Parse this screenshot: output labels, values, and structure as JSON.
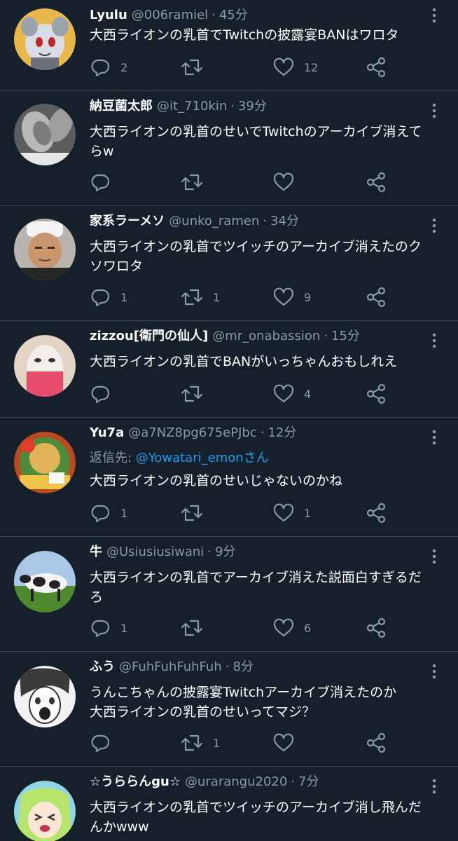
{
  "timeline": {
    "tweets": [
      {
        "name": "Lyulu",
        "handle": "@006ramiel",
        "time": "45分",
        "lines": [
          "大西ライオンの乳首でTwitchの披露宴BANはワロタ"
        ],
        "replies": "2",
        "retweets": "",
        "likes": "12"
      },
      {
        "name": "納豆菌太郎",
        "handle": "@it_710kin",
        "time": "39分",
        "lines": [
          "大西ライオンの乳首のせいでTwitchのアーカイブ消えて",
          "らw"
        ],
        "replies": "",
        "retweets": "",
        "likes": ""
      },
      {
        "name": "家系ラーメソ",
        "handle": "@unko_ramen",
        "time": "34分",
        "lines": [
          "大西ライオンの乳首でツイッチのアーカイブ消えたのク",
          "ソワロタ"
        ],
        "replies": "1",
        "retweets": "1",
        "likes": "9"
      },
      {
        "name": "zizzou[衛門の仙人]",
        "handle": "@mr_onabassion",
        "time": "15分",
        "lines": [
          "大西ライオンの乳首でBANがいっちゃんおもしれえ"
        ],
        "replies": "",
        "retweets": "",
        "likes": "4"
      },
      {
        "name": "Yu7a",
        "handle": "@a7NZ8pg675ePJbc",
        "time": "12分",
        "reply_prefix": "返信先:",
        "reply_mention": "@Yowatari_emonさん",
        "lines": [
          "大西ライオンの乳首のせいじゃないのかね"
        ],
        "replies": "1",
        "retweets": "",
        "likes": "1"
      },
      {
        "name": "牛",
        "handle": "@Usiusiusiwani",
        "time": "9分",
        "lines": [
          "大西ライオンの乳首でアーカイブ消えた説面白すぎるだ",
          "ろ"
        ],
        "replies": "1",
        "retweets": "",
        "likes": "6"
      },
      {
        "name": "ふう",
        "handle": "@FuhFuhFuhFuh",
        "time": "8分",
        "lines": [
          "うんこちゃんの披露宴Twitchアーカイブ消えたのか",
          "大西ライオンの乳首のせいってマジ？"
        ],
        "replies": "",
        "retweets": "1",
        "likes": ""
      },
      {
        "name": "☆うららんgu☆",
        "handle": "@urarangu2020",
        "time": "7分",
        "lines": [
          "大西ライオンの乳首でツイッチのアーカイブ消し飛んだ",
          "んかwww"
        ],
        "replies": "",
        "retweets": "",
        "likes": ""
      }
    ]
  },
  "icons": {
    "reply": "reply-icon",
    "retweet": "retweet-icon",
    "like": "heart-icon",
    "share": "share-icon",
    "more": "more-options-icon"
  },
  "colors": {
    "background": "#15202b",
    "divider": "#38444d",
    "muted": "#8b98a5",
    "link": "#1d9bf0"
  }
}
